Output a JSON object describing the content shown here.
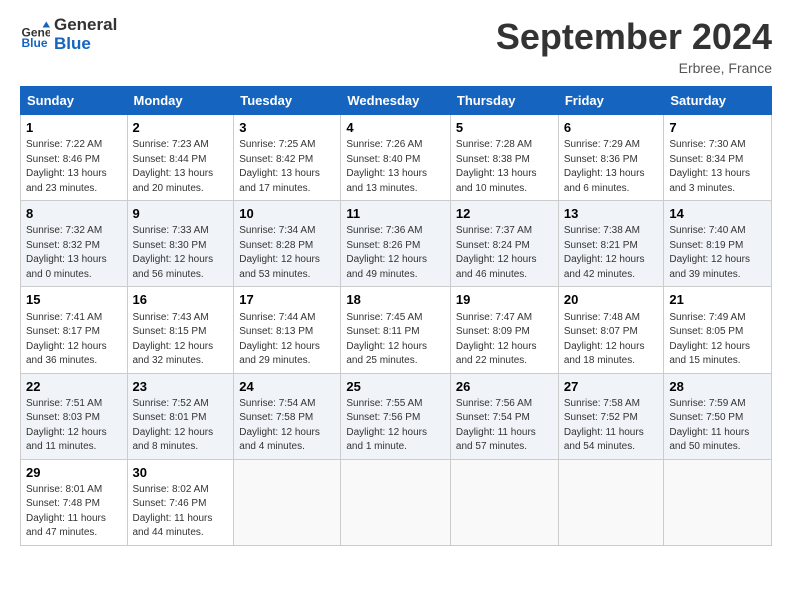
{
  "header": {
    "logo_line1": "General",
    "logo_line2": "Blue",
    "month_title": "September 2024",
    "location": "Erbree, France"
  },
  "weekdays": [
    "Sunday",
    "Monday",
    "Tuesday",
    "Wednesday",
    "Thursday",
    "Friday",
    "Saturday"
  ],
  "weeks": [
    [
      {
        "day": "1",
        "sunrise": "Sunrise: 7:22 AM",
        "sunset": "Sunset: 8:46 PM",
        "daylight": "Daylight: 13 hours and 23 minutes."
      },
      {
        "day": "2",
        "sunrise": "Sunrise: 7:23 AM",
        "sunset": "Sunset: 8:44 PM",
        "daylight": "Daylight: 13 hours and 20 minutes."
      },
      {
        "day": "3",
        "sunrise": "Sunrise: 7:25 AM",
        "sunset": "Sunset: 8:42 PM",
        "daylight": "Daylight: 13 hours and 17 minutes."
      },
      {
        "day": "4",
        "sunrise": "Sunrise: 7:26 AM",
        "sunset": "Sunset: 8:40 PM",
        "daylight": "Daylight: 13 hours and 13 minutes."
      },
      {
        "day": "5",
        "sunrise": "Sunrise: 7:28 AM",
        "sunset": "Sunset: 8:38 PM",
        "daylight": "Daylight: 13 hours and 10 minutes."
      },
      {
        "day": "6",
        "sunrise": "Sunrise: 7:29 AM",
        "sunset": "Sunset: 8:36 PM",
        "daylight": "Daylight: 13 hours and 6 minutes."
      },
      {
        "day": "7",
        "sunrise": "Sunrise: 7:30 AM",
        "sunset": "Sunset: 8:34 PM",
        "daylight": "Daylight: 13 hours and 3 minutes."
      }
    ],
    [
      {
        "day": "8",
        "sunrise": "Sunrise: 7:32 AM",
        "sunset": "Sunset: 8:32 PM",
        "daylight": "Daylight: 13 hours and 0 minutes."
      },
      {
        "day": "9",
        "sunrise": "Sunrise: 7:33 AM",
        "sunset": "Sunset: 8:30 PM",
        "daylight": "Daylight: 12 hours and 56 minutes."
      },
      {
        "day": "10",
        "sunrise": "Sunrise: 7:34 AM",
        "sunset": "Sunset: 8:28 PM",
        "daylight": "Daylight: 12 hours and 53 minutes."
      },
      {
        "day": "11",
        "sunrise": "Sunrise: 7:36 AM",
        "sunset": "Sunset: 8:26 PM",
        "daylight": "Daylight: 12 hours and 49 minutes."
      },
      {
        "day": "12",
        "sunrise": "Sunrise: 7:37 AM",
        "sunset": "Sunset: 8:24 PM",
        "daylight": "Daylight: 12 hours and 46 minutes."
      },
      {
        "day": "13",
        "sunrise": "Sunrise: 7:38 AM",
        "sunset": "Sunset: 8:21 PM",
        "daylight": "Daylight: 12 hours and 42 minutes."
      },
      {
        "day": "14",
        "sunrise": "Sunrise: 7:40 AM",
        "sunset": "Sunset: 8:19 PM",
        "daylight": "Daylight: 12 hours and 39 minutes."
      }
    ],
    [
      {
        "day": "15",
        "sunrise": "Sunrise: 7:41 AM",
        "sunset": "Sunset: 8:17 PM",
        "daylight": "Daylight: 12 hours and 36 minutes."
      },
      {
        "day": "16",
        "sunrise": "Sunrise: 7:43 AM",
        "sunset": "Sunset: 8:15 PM",
        "daylight": "Daylight: 12 hours and 32 minutes."
      },
      {
        "day": "17",
        "sunrise": "Sunrise: 7:44 AM",
        "sunset": "Sunset: 8:13 PM",
        "daylight": "Daylight: 12 hours and 29 minutes."
      },
      {
        "day": "18",
        "sunrise": "Sunrise: 7:45 AM",
        "sunset": "Sunset: 8:11 PM",
        "daylight": "Daylight: 12 hours and 25 minutes."
      },
      {
        "day": "19",
        "sunrise": "Sunrise: 7:47 AM",
        "sunset": "Sunset: 8:09 PM",
        "daylight": "Daylight: 12 hours and 22 minutes."
      },
      {
        "day": "20",
        "sunrise": "Sunrise: 7:48 AM",
        "sunset": "Sunset: 8:07 PM",
        "daylight": "Daylight: 12 hours and 18 minutes."
      },
      {
        "day": "21",
        "sunrise": "Sunrise: 7:49 AM",
        "sunset": "Sunset: 8:05 PM",
        "daylight": "Daylight: 12 hours and 15 minutes."
      }
    ],
    [
      {
        "day": "22",
        "sunrise": "Sunrise: 7:51 AM",
        "sunset": "Sunset: 8:03 PM",
        "daylight": "Daylight: 12 hours and 11 minutes."
      },
      {
        "day": "23",
        "sunrise": "Sunrise: 7:52 AM",
        "sunset": "Sunset: 8:01 PM",
        "daylight": "Daylight: 12 hours and 8 minutes."
      },
      {
        "day": "24",
        "sunrise": "Sunrise: 7:54 AM",
        "sunset": "Sunset: 7:58 PM",
        "daylight": "Daylight: 12 hours and 4 minutes."
      },
      {
        "day": "25",
        "sunrise": "Sunrise: 7:55 AM",
        "sunset": "Sunset: 7:56 PM",
        "daylight": "Daylight: 12 hours and 1 minute."
      },
      {
        "day": "26",
        "sunrise": "Sunrise: 7:56 AM",
        "sunset": "Sunset: 7:54 PM",
        "daylight": "Daylight: 11 hours and 57 minutes."
      },
      {
        "day": "27",
        "sunrise": "Sunrise: 7:58 AM",
        "sunset": "Sunset: 7:52 PM",
        "daylight": "Daylight: 11 hours and 54 minutes."
      },
      {
        "day": "28",
        "sunrise": "Sunrise: 7:59 AM",
        "sunset": "Sunset: 7:50 PM",
        "daylight": "Daylight: 11 hours and 50 minutes."
      }
    ],
    [
      {
        "day": "29",
        "sunrise": "Sunrise: 8:01 AM",
        "sunset": "Sunset: 7:48 PM",
        "daylight": "Daylight: 11 hours and 47 minutes."
      },
      {
        "day": "30",
        "sunrise": "Sunrise: 8:02 AM",
        "sunset": "Sunset: 7:46 PM",
        "daylight": "Daylight: 11 hours and 44 minutes."
      },
      null,
      null,
      null,
      null,
      null
    ]
  ]
}
